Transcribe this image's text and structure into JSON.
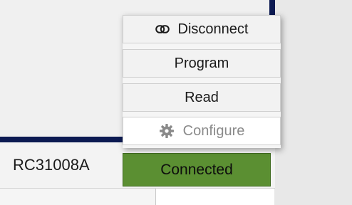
{
  "menu": {
    "items": [
      {
        "label": "Disconnect",
        "icon": "link-icon",
        "enabled": true
      },
      {
        "label": "Program",
        "enabled": true
      },
      {
        "label": "Read",
        "enabled": true
      },
      {
        "label": "Configure",
        "icon": "gear-icon",
        "enabled": false
      }
    ]
  },
  "status": {
    "device_name": "RC31008A",
    "connection_label": "Connected",
    "connection_color": "#5b8f32"
  }
}
